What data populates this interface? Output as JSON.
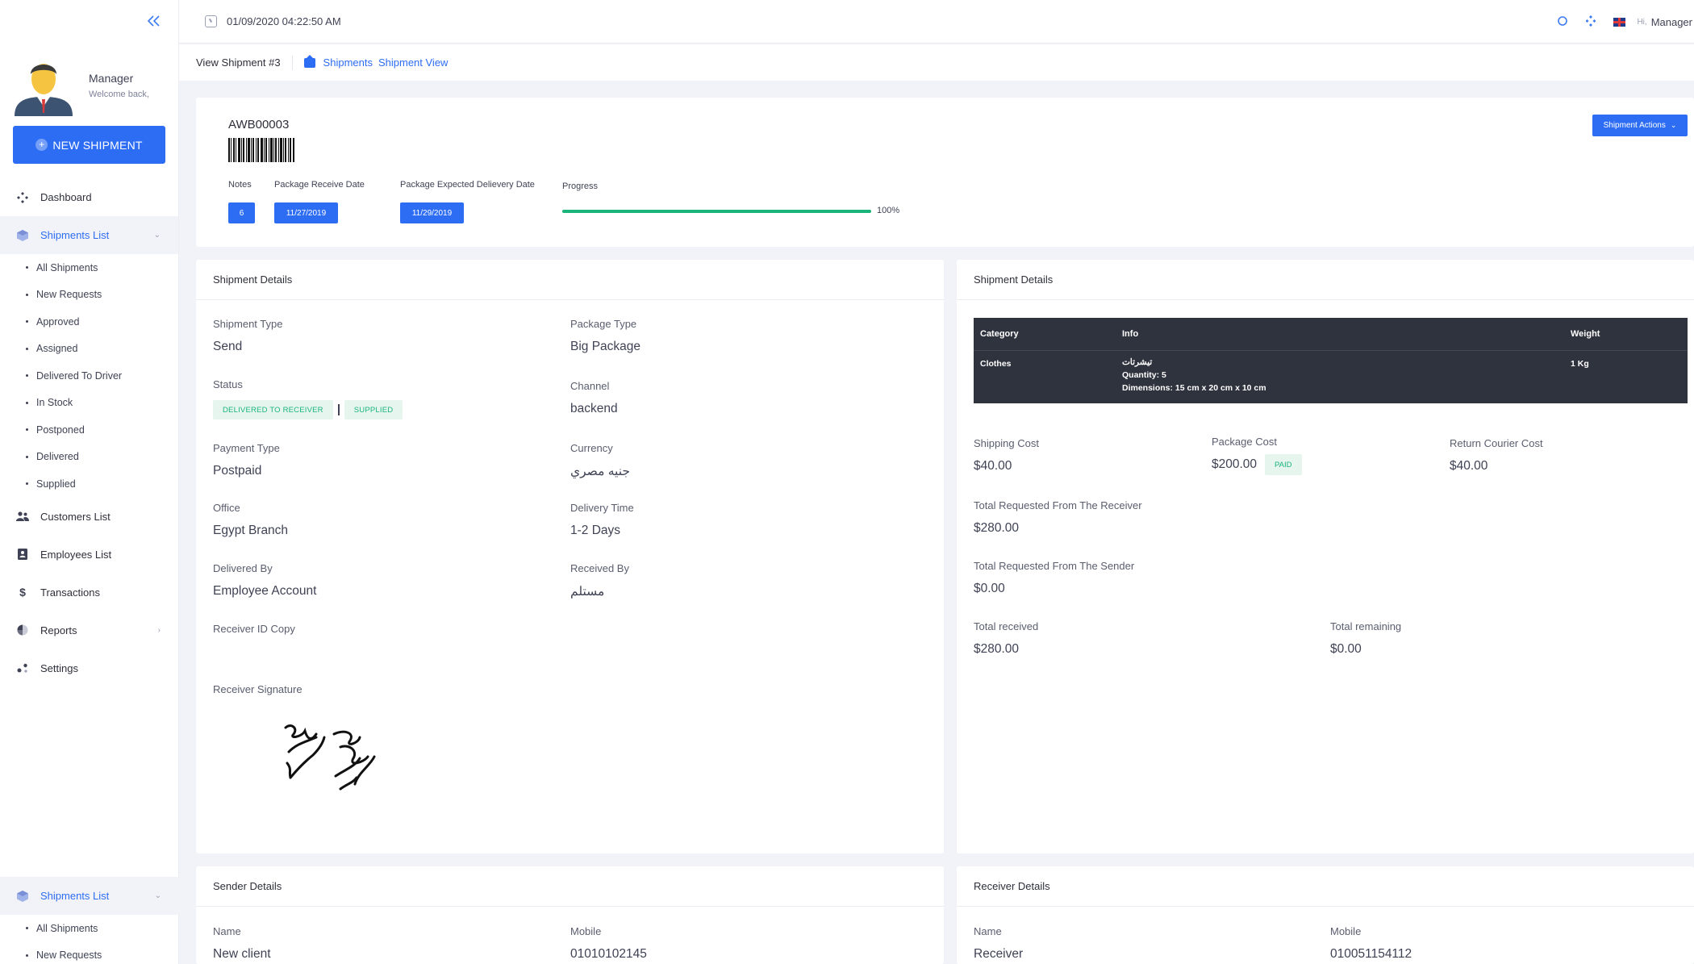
{
  "topbar": {
    "datetime": "01/09/2020 04:22:50 AM",
    "greeting": "Hi,",
    "user_name": "Manager"
  },
  "profile": {
    "name": "Manager",
    "subtitle": "Welcome back,"
  },
  "sidebar": {
    "new_button": "NEW SHIPMENT",
    "items": {
      "dashboard": "Dashboard",
      "shipments": "Shipments List",
      "customers": "Customers List",
      "employees": "Employees List",
      "transactions": "Transactions",
      "reports": "Reports",
      "settings": "Settings"
    },
    "shipment_sub": [
      "All Shipments",
      "New Requests",
      "Approved",
      "Assigned",
      "Delivered To Driver",
      "In Stock",
      "Postponed",
      "Delivered",
      "Supplied"
    ],
    "bottom_group": {
      "label": "Shipments List",
      "sub": [
        "All Shipments",
        "New Requests"
      ]
    }
  },
  "subheader": {
    "title": "View Shipment #3",
    "breadcrumb_1": "Shipments",
    "breadcrumb_2": "Shipment View"
  },
  "summary": {
    "awb": "AWB00003",
    "notes_label": "Notes",
    "notes_value": "6",
    "receive_label": "Package Receive Date",
    "receive_value": "11/27/2019",
    "expected_label": "Package Expected Delievery Date",
    "expected_value": "11/29/2019",
    "progress_label": "Progress",
    "progress_value": 100,
    "progress_text": "100%",
    "actions_button": "Shipment Actions"
  },
  "details": {
    "title": "Shipment Details",
    "shipment_type_label": "Shipment Type",
    "shipment_type": "Send",
    "package_type_label": "Package Type",
    "package_type": "Big Package",
    "status_label": "Status",
    "status_1": "DELIVERED TO RECEIVER",
    "status_2": "SUPPLIED",
    "channel_label": "Channel",
    "channel": "backend",
    "payment_label": "Payment Type",
    "payment": "Postpaid",
    "currency_label": "Currency",
    "currency": "جنيه مصري",
    "office_label": "Office",
    "office": "Egypt Branch",
    "delivery_time_label": "Delivery Time",
    "delivery_time": "1-2 Days",
    "delivered_by_label": "Delivered By",
    "delivered_by": "Employee Account",
    "received_by_label": "Received By",
    "received_by": "مستلم",
    "receiver_id_label": "Receiver ID Copy",
    "signature_label": "Receiver Signature"
  },
  "costs": {
    "title": "Shipment Details",
    "table": {
      "headers": [
        "Category",
        "Info",
        "Weight"
      ],
      "row": {
        "category": "Clothes",
        "info_title": "تيشرتات",
        "quantity": "Quantity: 5",
        "dimensions": "Dimensions: 15 cm x 20 cm x 10 cm",
        "weight": "1 Kg"
      }
    },
    "shipping_label": "Shipping Cost",
    "shipping": "$40.00",
    "package_label": "Package Cost",
    "package": "$200.00",
    "paid_badge": "PAID",
    "return_label": "Return Courier Cost",
    "return": "$40.00",
    "req_receiver_label": "Total Requested From The Receiver",
    "req_receiver": "$280.00",
    "req_sender_label": "Total Requested From The Sender",
    "req_sender": "$0.00",
    "received_label": "Total received",
    "received": "$280.00",
    "remaining_label": "Total remaining",
    "remaining": "$0.00"
  },
  "sender": {
    "title": "Sender Details",
    "name_label": "Name",
    "name": "New client",
    "mobile_label": "Mobile",
    "mobile": "01010102145"
  },
  "receiver": {
    "title": "Receiver Details",
    "name_label": "Name",
    "name": "Receiver",
    "mobile_label": "Mobile",
    "mobile": "010051154112"
  },
  "colors": {
    "primary": "#2d6df3",
    "success": "#1bb47a",
    "table_bg": "#2f333e"
  }
}
